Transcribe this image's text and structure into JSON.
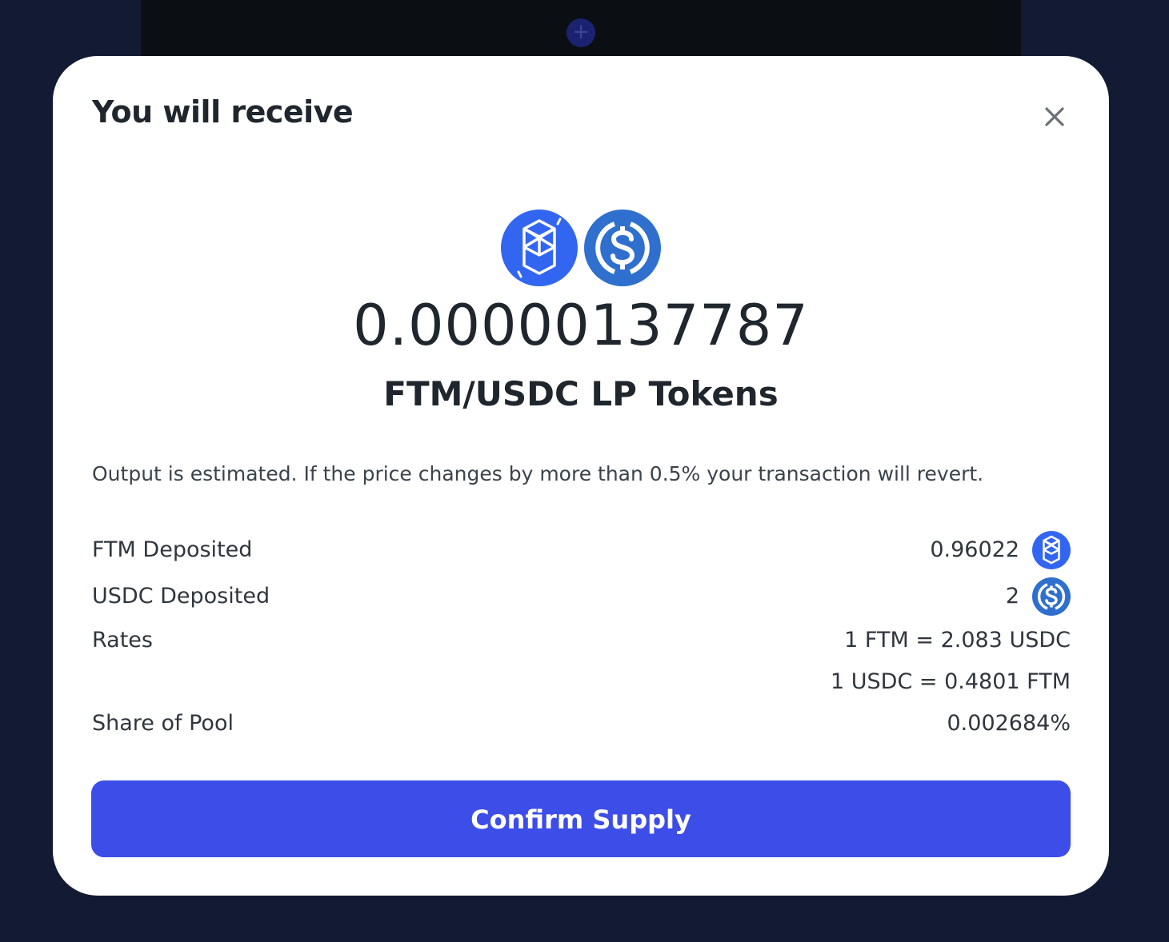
{
  "background": {
    "plus_glyph": "+"
  },
  "modal": {
    "title": "You will receive",
    "close_icon": "close-icon",
    "amount": "0.00000137787",
    "lp_label": "FTM/USDC LP Tokens",
    "note": "Output is estimated. If the price changes by more than 0.5% your transaction will revert.",
    "details": {
      "ftm_deposited_label": "FTM Deposited",
      "ftm_deposited_value": "0.96022",
      "usdc_deposited_label": "USDC Deposited",
      "usdc_deposited_value": "2",
      "rates_label": "Rates",
      "rate_ftm_usdc": "1 FTM = 2.083 USDC",
      "rate_usdc_ftm": "1 USDC = 0.4801 FTM",
      "share_label": "Share of Pool",
      "share_value": "0.002684%"
    },
    "confirm_label": "Confirm Supply"
  },
  "colors": {
    "page_bg": "#131a33",
    "modal_bg": "#ffffff",
    "accent": "#3d4de8",
    "ftm_blue": "#3366f0",
    "usdc_blue": "#2f6fce",
    "text": "#1f262d"
  }
}
